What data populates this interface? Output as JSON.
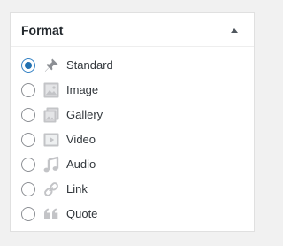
{
  "metabox": {
    "title": "Format",
    "toggle_icon": "triangle-up-icon"
  },
  "formats": [
    {
      "label": "Standard",
      "icon": "pin-icon",
      "checked": true
    },
    {
      "label": "Image",
      "icon": "image-icon",
      "checked": false
    },
    {
      "label": "Gallery",
      "icon": "gallery-icon",
      "checked": false
    },
    {
      "label": "Video",
      "icon": "video-icon",
      "checked": false
    },
    {
      "label": "Audio",
      "icon": "audio-icon",
      "checked": false
    },
    {
      "label": "Link",
      "icon": "link-icon",
      "checked": false
    },
    {
      "label": "Quote",
      "icon": "quote-icon",
      "checked": false
    }
  ],
  "colors": {
    "accent": "#2271b1",
    "icon_gray": "#c3c4c7",
    "pin_gray": "#8c8f94"
  }
}
